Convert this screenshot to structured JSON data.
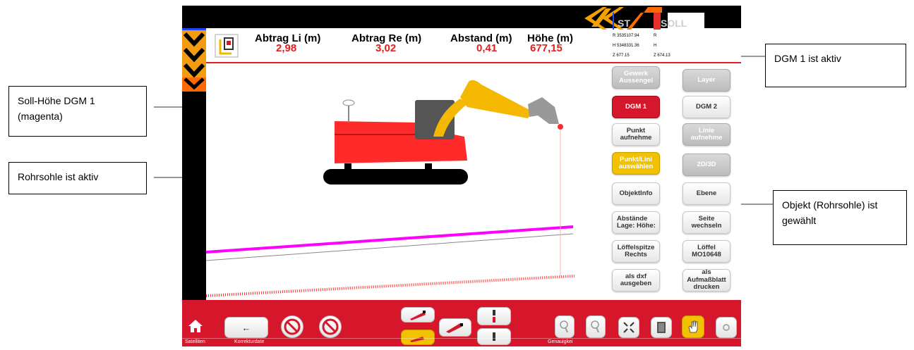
{
  "callouts": {
    "soll_hoehe": "Soll-Höhe DGM 1 (magenta)",
    "rohrsohle": "Rohrsohle  ist aktiv",
    "dgm_aktiv": "DGM 1 ist aktiv",
    "objekt_gewaehlt": "Objekt (Rohrsohle) ist gewählt"
  },
  "header": {
    "metrics": [
      {
        "label": "Abtrag Li (m)",
        "value": "2,98"
      },
      {
        "label": "Abtrag Re (m)",
        "value": "3,02"
      },
      {
        "label": "Abstand (m)",
        "value": "0,41"
      },
      {
        "label": "Höhe (m)",
        "value": "677,15"
      }
    ],
    "st_label": "ST",
    "soll_label": "SOLL",
    "coords": {
      "r_ist": "R 3535107.94",
      "r_soll": "R",
      "h_ist": "H 5348331.36",
      "h_soll": "H",
      "z_ist": "Z 677.15",
      "z_soll": "Z 674.13"
    }
  },
  "right_panel": {
    "gewerk": "Gewerk Aussengel",
    "layer": "Layer",
    "dgm1": "DGM 1",
    "dgm2": "DGM 2",
    "punkt_aufnehmen": "Punkt aufnehme",
    "linie_aufnehmen": "Linie aufnehme",
    "punkt_linie_auswaehlen": "Punkt/Lini auswählen",
    "view_2d3d": "2D/3D",
    "objektinfo": "ObjektInfo",
    "ebene": "Ebene",
    "abstaende": "Abstände Lage: Höhe:",
    "seite_wechseln": "Seite wechseln",
    "loeffelspitze": "Löffelspitze Rechts",
    "loeffel": "Löffel MO10648",
    "als_dxf": "als dxf ausgeben",
    "als_aufmassblatt": "als Aufmaßblatt drucken"
  },
  "bottom_bar": {
    "labels": {
      "satelliten": "Satelliten",
      "korrekturdaten": "Korrekturdate",
      "genauigkeit": "Genauigkei"
    },
    "back_glyph": "←"
  },
  "colors": {
    "accent_red": "#d6162a",
    "magenta": "#ff00ff",
    "excavator_red": "#ff2a2a",
    "arm_yellow": "#f5b800",
    "selected_yellow": "#f2c200"
  }
}
